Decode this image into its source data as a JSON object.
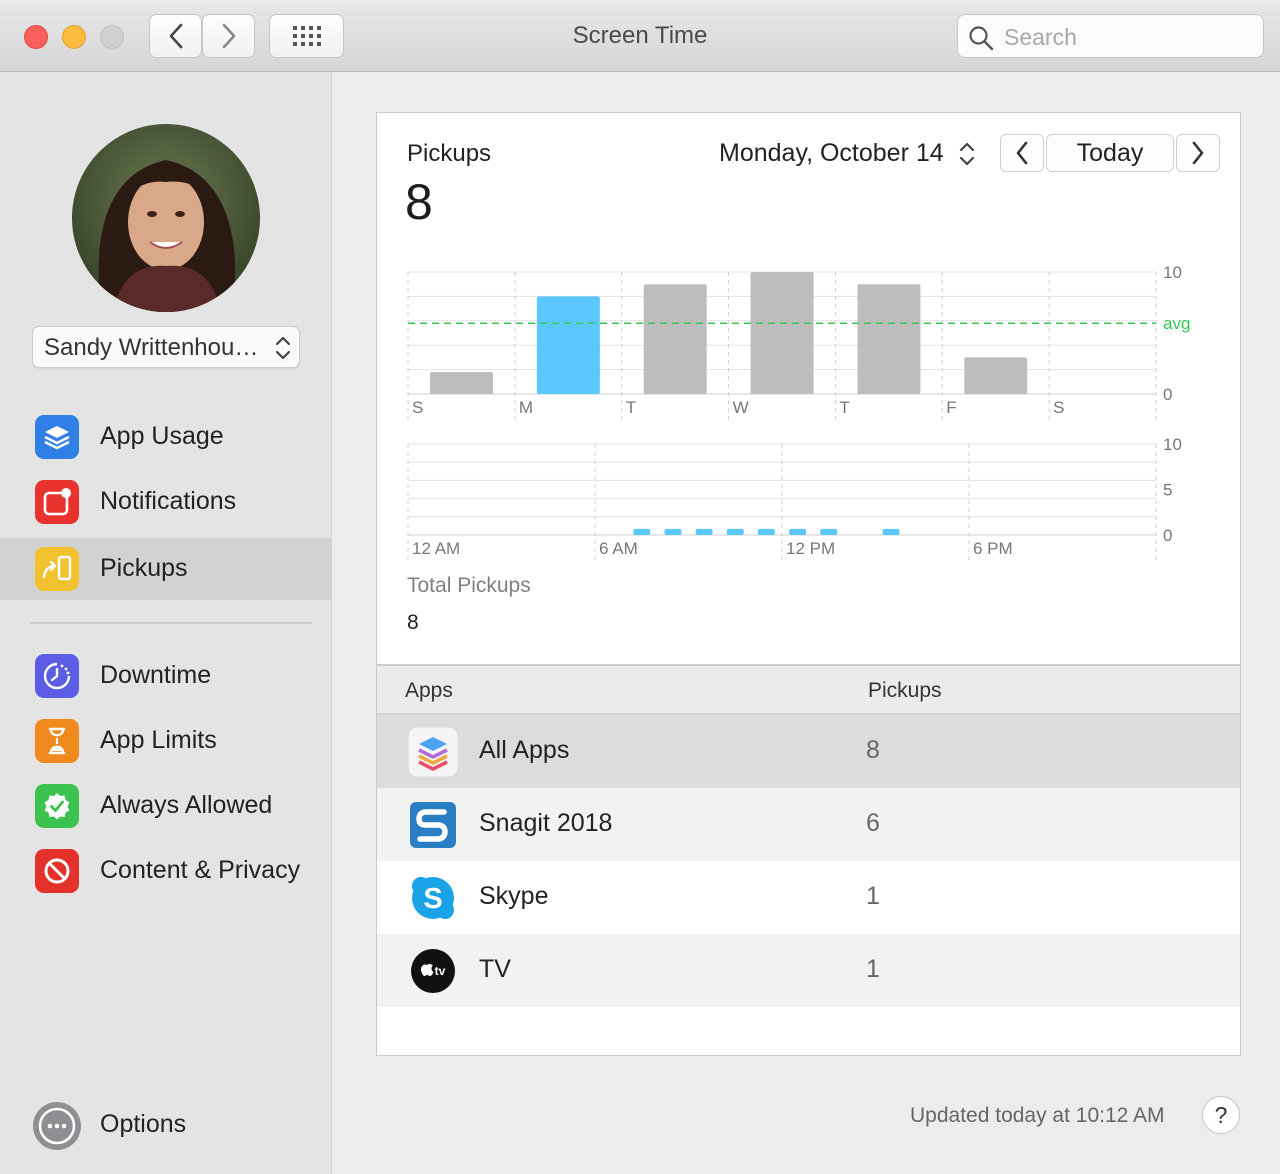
{
  "window": {
    "title": "Screen Time"
  },
  "search": {
    "placeholder": "Search"
  },
  "sidebar": {
    "user": "Sandy Writtenhou…",
    "items": [
      {
        "label": "App Usage",
        "icon": "stack-layers-icon",
        "color": "#2f7fe6"
      },
      {
        "label": "Notifications",
        "icon": "notification-badge-icon",
        "color": "#e8322d"
      },
      {
        "label": "Pickups",
        "icon": "pickup-phone-icon",
        "color": "#f2c12e",
        "selected": true
      },
      {
        "label": "Downtime",
        "icon": "downtime-clock-icon",
        "color": "#5b5ee4"
      },
      {
        "label": "App Limits",
        "icon": "hourglass-icon",
        "color": "#f08a1c"
      },
      {
        "label": "Always Allowed",
        "icon": "checkmark-seal-icon",
        "color": "#3cc24f"
      },
      {
        "label": "Content & Privacy",
        "icon": "no-entry-icon",
        "color": "#e4312c"
      }
    ],
    "options": {
      "label": "Options",
      "icon": "ellipsis-circle-icon"
    }
  },
  "panel": {
    "title": "Pickups",
    "value": "8",
    "date_label": "Monday, October 14",
    "today_label": "Today",
    "total_label": "Total Pickups",
    "total_value": "8"
  },
  "chart_data": [
    {
      "type": "bar",
      "categories": [
        "S",
        "M",
        "T",
        "W",
        "T",
        "F",
        "S"
      ],
      "values": [
        1.8,
        8.0,
        9.0,
        10.0,
        9.0,
        3.0,
        0
      ],
      "highlight_index": 1,
      "avg": 5.8,
      "avg_label": "avg",
      "ylim": [
        0,
        10
      ],
      "ytick_labels": [
        "10",
        "0"
      ],
      "colors": {
        "bar": "#bdbdbd",
        "highlight": "#5ac8fa",
        "avg": "#34c759"
      }
    },
    {
      "type": "bar",
      "x_labels": [
        "12 AM",
        "6 AM",
        "12 PM",
        "6 PM"
      ],
      "hours": [
        7,
        8,
        9,
        10,
        11,
        12,
        13,
        15
      ],
      "values": [
        1,
        1,
        1,
        1,
        1,
        1,
        1,
        1
      ],
      "ylim": [
        0,
        10
      ],
      "ytick_labels": [
        "10",
        "5",
        "0"
      ],
      "colors": {
        "bar": "#5ac8fa"
      }
    }
  ],
  "table": {
    "headers": {
      "apps": "Apps",
      "pickups": "Pickups"
    },
    "rows": [
      {
        "name": "All Apps",
        "value": "8",
        "icon": "all-apps-stack-icon",
        "selected": true
      },
      {
        "name": "Snagit 2018",
        "value": "6",
        "icon": "snagit-icon"
      },
      {
        "name": "Skype",
        "value": "1",
        "icon": "skype-icon"
      },
      {
        "name": "TV",
        "value": "1",
        "icon": "apple-tv-icon"
      }
    ]
  },
  "footer": {
    "updated": "Updated today at 10:12 AM",
    "help": "?"
  }
}
